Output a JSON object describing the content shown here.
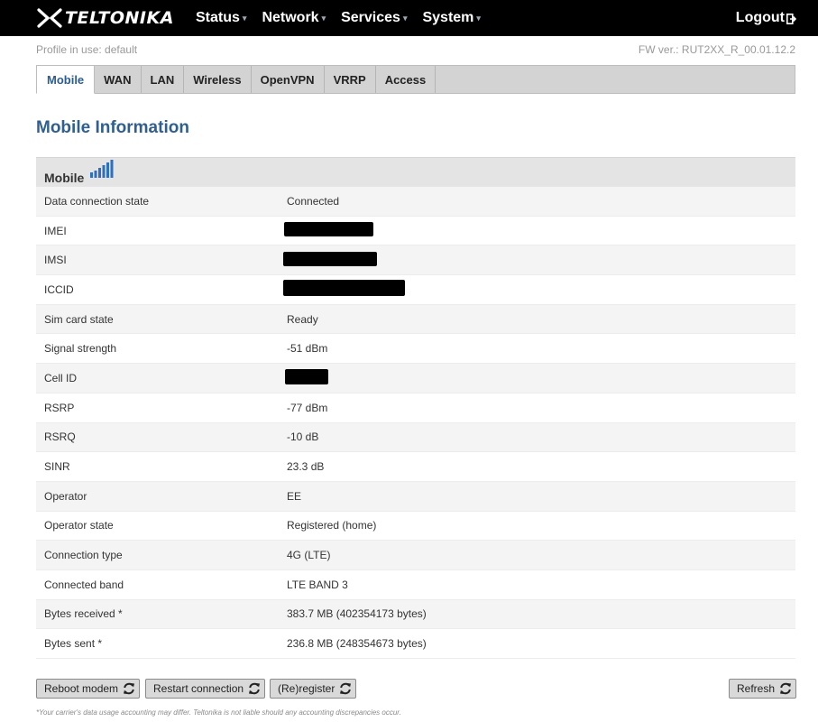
{
  "header": {
    "logo_text": "TELTONIKA",
    "nav": [
      {
        "label": "Status"
      },
      {
        "label": "Network"
      },
      {
        "label": "Services"
      },
      {
        "label": "System"
      }
    ],
    "logout_label": "Logout"
  },
  "profile_text": "Profile in use: default",
  "fw_version": "FW ver.: RUT2XX_R_00.01.12.2",
  "tabs": [
    {
      "label": "Mobile",
      "active": true
    },
    {
      "label": "WAN"
    },
    {
      "label": "LAN"
    },
    {
      "label": "Wireless"
    },
    {
      "label": "OpenVPN"
    },
    {
      "label": "VRRP"
    },
    {
      "label": "Access"
    }
  ],
  "page_title": "Mobile Information",
  "section_title": "Mobile",
  "rows": [
    {
      "label": "Data connection state",
      "value": "Connected"
    },
    {
      "label": "IMEI",
      "value": ""
    },
    {
      "label": "IMSI",
      "value": ""
    },
    {
      "label": "ICCID",
      "value": ""
    },
    {
      "label": "Sim card state",
      "value": "Ready"
    },
    {
      "label": "Signal strength",
      "value": "-51 dBm"
    },
    {
      "label": "Cell ID",
      "value": ""
    },
    {
      "label": "RSRP",
      "value": "-77 dBm"
    },
    {
      "label": "RSRQ",
      "value": "-10 dB"
    },
    {
      "label": "SINR",
      "value": "23.3 dB"
    },
    {
      "label": "Operator",
      "value": "EE"
    },
    {
      "label": "Operator state",
      "value": "Registered (home)"
    },
    {
      "label": "Connection type",
      "value": "4G (LTE)"
    },
    {
      "label": "Connected band",
      "value": "LTE BAND 3"
    },
    {
      "label": "Bytes received *",
      "value": "383.7 MB (402354173 bytes)"
    },
    {
      "label": "Bytes sent *",
      "value": "236.8 MB (248354673 bytes)"
    }
  ],
  "buttons": {
    "reboot": "Reboot modem",
    "restart": "Restart connection",
    "reregister": "(Re)register",
    "refresh": "Refresh"
  },
  "footnote": "*Your carrier's data usage accounting may differ. Teltonika is not liable should any accounting discrepancies occur.",
  "icons": {
    "signal": "signal-bars-icon",
    "refresh": "refresh-icon",
    "logout": "logout-icon"
  },
  "colors": {
    "accent": "#2f5f8f",
    "topbar": "#000000"
  }
}
